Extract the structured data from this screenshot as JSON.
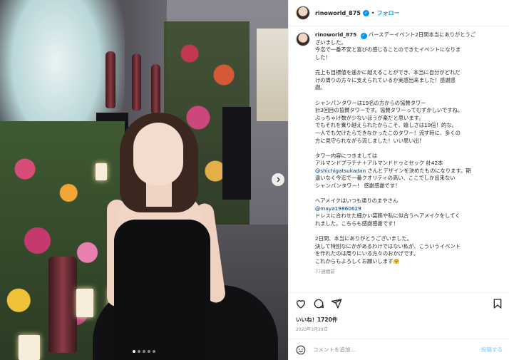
{
  "header": {
    "username": "rinoworld_875",
    "separator": "•",
    "follow_label": "フォロー"
  },
  "caption": {
    "username": "rinoworld_875",
    "lines": [
      "バースデーイベント2日間本当にありがとうご",
      "ざいました。",
      "今迄で一番不安と喜びの感じることのできたイベントになりま",
      "した！",
      "",
      "売上も目標値を遥かに越えることができ、本当に自分がどれだ",
      "けの周りの方々に支えられているか実感出来ました！感謝感",
      "謝。",
      "",
      "シャンパンタワーは19名の方からの協賛タワー",
      "計3回目の協賛タワーです。協賛タワーってむずかしいですね。",
      "ぶっちゃけ数が少ないほうが楽だと思います。",
      "でもそれを乗り越えられたからこそ、嬉しさは19倍！的な。",
      "一人でも欠けたらできなかったこのタワー！流す時に、多くの",
      "方に見守られながら流しました！いい思い出！",
      "",
      "タワー内容につきましては",
      "アルマンドプラチナ＋アルマンドドゥミセック 計42本"
    ],
    "mention1": "@shichigatsukadan",
    "mention1_suffix": " さんとデザインを決めたものになります。期",
    "lines2": [
      "違いなく今迄で一番クオリティの高い、ここでしか出来ない",
      "シャンパンタワー！ 感謝感謝です！",
      "",
      "ヘアメイクはいつも通りのまやさん"
    ],
    "mention2": "@maya19860629",
    "lines3": [
      "ドレスに合わせた細かい装飾や私に似合うヘアメイクをしてく",
      "れました。こちらも感謝感謝です！",
      "",
      "2日間、本当にありがとうございました。",
      "決して特別なにかがあるわけではない私が、こういうイベント",
      "を作れたのは周りにいる方々のおかげです。",
      "これからもよろしくお願いします🤗"
    ],
    "time_ago": "77週間前"
  },
  "likes_text": "いいね！1720件",
  "date_text": "2023年3月29日",
  "comment": {
    "placeholder": "コメントを追加...",
    "post_label": "投稿する"
  },
  "carousel": {
    "slide_count": 5,
    "active_index": 0
  },
  "colors": {
    "accent": "#0095f6",
    "mention": "#00376b",
    "muted": "#8e8e8e"
  },
  "icons": [
    "heart-icon",
    "comment-icon",
    "share-icon",
    "bookmark-icon",
    "emoji-icon",
    "chevron-right-icon",
    "verified-icon"
  ]
}
